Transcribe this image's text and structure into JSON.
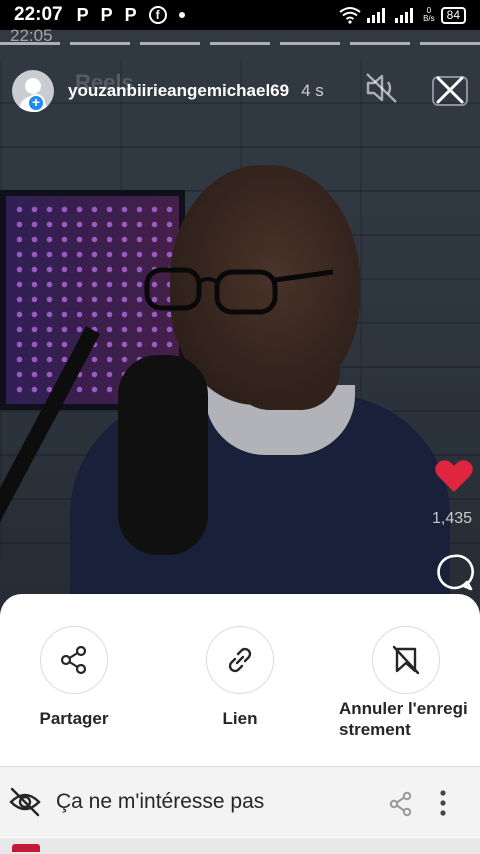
{
  "status_bar": {
    "time": "22:07",
    "notification_icons": [
      "P",
      "P",
      "P"
    ],
    "facebook_icon": "f",
    "speed_value": "0",
    "speed_unit": "B/s",
    "battery": "84"
  },
  "ghost_status": {
    "time": "22:05"
  },
  "reel": {
    "ghost_title": "Reels",
    "username": "youzanbiirieangemichael69",
    "time_ago": "4 s",
    "likes_count": "1,435"
  },
  "sheet": {
    "actions": [
      {
        "label": "Partager",
        "icon": "share-icon"
      },
      {
        "label": "Lien",
        "icon": "link-icon"
      },
      {
        "label": "Annuler l'enregistrement",
        "icon": "unsave-bookmark-icon"
      }
    ],
    "not_interested_label": "Ça ne m'intéresse pas"
  },
  "colors": {
    "like_red": "#e0253f",
    "avatar_plus_blue": "#1e8cf0",
    "sheet_text": "#262626"
  }
}
